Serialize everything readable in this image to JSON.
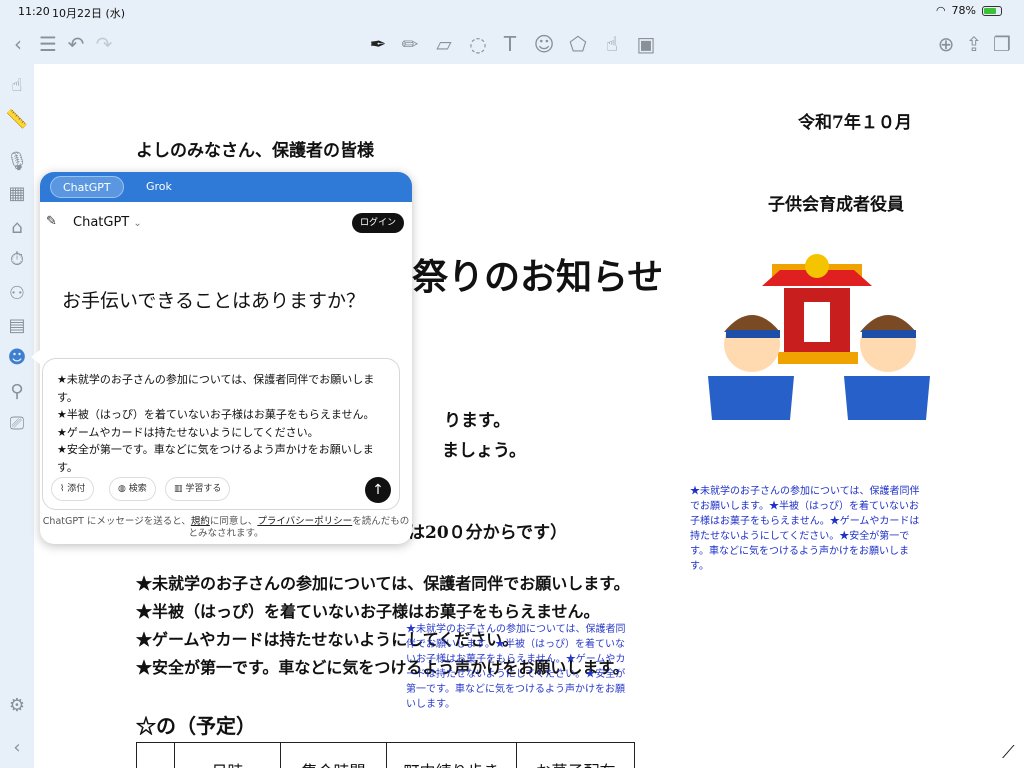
{
  "status": {
    "time": "11:20",
    "date": "10月22日 (水)",
    "battery": "78%",
    "battery_level": 0.78
  },
  "colors": {
    "accent": "#2f7ad6",
    "note_blue": "#1f31c8"
  },
  "document": {
    "date": "令和7年１０月",
    "greeting": "よしのみなさん、保護者の皆様",
    "sender": "子供会育成者役員",
    "title": "祭りのお知らせ",
    "line1": "ります。",
    "line2": "ましょう。",
    "time_note": "は20０分からです）",
    "notes": [
      "★未就学のお子さんの参加については、保護者同伴でお願いします。",
      "★半被（はっぴ）を着ていないお子様はお菓子をもらえません。",
      "★ゲームやカードは持たせないようにしてください。",
      "★安全が第一です。車などに気をつけるよう声かけをお願いします。"
    ],
    "schedule_heading": "☆の（予定）",
    "table_headers": [
      "",
      "日時",
      "集合時間",
      "町内練り歩き",
      "お菓子配布"
    ],
    "blue_note_right": "★未就学のお子さんの参加については、保護者同伴でお願いします。★半被（はっぴ）を着ていないお子様はお菓子をもらえません。★ゲームやカードは持たせないようにしてください。★安全が第一です。車などに気をつけるよう声かけをお願いします。",
    "blue_note_mid": "★未就学のお子さんの参加については、保護者同伴でお願いします。★半被（はっぴ）を着ていないお子様はお菓子をもらえません。★ゲームやカードは持たせないようにしてください。★安全が第一です。車などに気をつけるよう声かけをお願いします。"
  },
  "chat": {
    "tabs": [
      "ChatGPT",
      "Grok"
    ],
    "model": "ChatGPT",
    "login": "ログイン",
    "prompt": "お手伝いできることはありますか？",
    "input_lines": [
      "★未就学のお子さんの参加については、保護者同伴でお願いします。",
      "★半被（はっぴ）を着ていないお子様はお菓子をもらえません。",
      "★ゲームやカードは持たせないようにしてください。",
      "★安全が第一です。車などに気をつけるよう声かけをお願いします。"
    ],
    "actions": [
      "添付",
      "検索",
      "学習する"
    ],
    "legal_prefix": "ChatGPT にメッセージを送ると、",
    "legal_terms": "規約",
    "legal_mid": "に同意し、",
    "legal_privacy": "プライバシーポリシー",
    "legal_suffix": "を読んだものとみなされます。"
  }
}
